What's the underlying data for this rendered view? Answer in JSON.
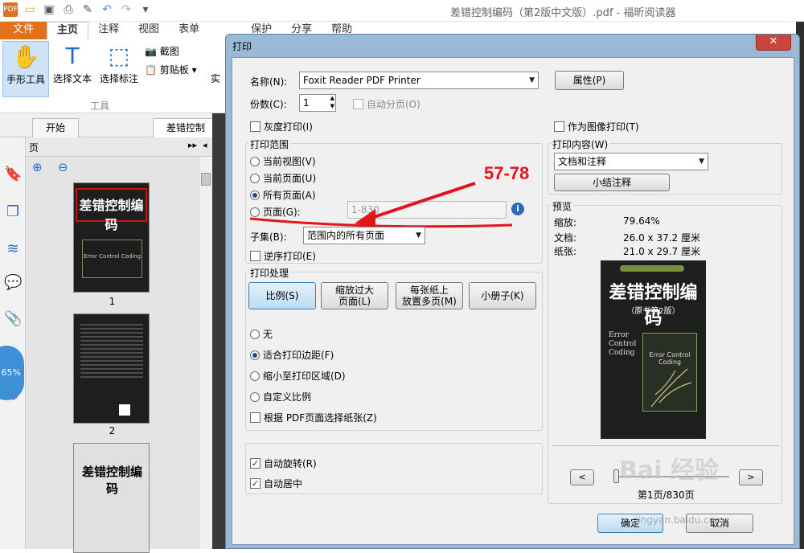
{
  "app": {
    "title": "差错控制编码（第2版中文版）.pdf - 福昕阅读器",
    "ribbon_tabs": [
      "文件",
      "主页",
      "注释",
      "视图",
      "表单",
      "保护",
      "分享",
      "帮助"
    ],
    "tools": {
      "hand": "手形工具",
      "select_text": "选择文本",
      "select_annot": "选择标注",
      "screenshot": "截图",
      "clipboard": "剪贴板",
      "partial": "实",
      "group_label": "工具"
    },
    "doc_tabs": [
      "开始",
      "差错控制编码"
    ],
    "panel_title": "页",
    "zoom": "65%",
    "thumbnails": [
      "1",
      "2"
    ],
    "thumb_text": {
      "cover_title": "差错控制编码",
      "cover_sub": "（原书第2版）",
      "cover_en": "Error Control Coding"
    }
  },
  "dialog": {
    "title": "打印",
    "close": "✕",
    "printer": {
      "name_label": "名称(N):",
      "name_value": "Foxit Reader PDF Printer",
      "properties": "属性(P)",
      "copies_label": "份数(C):",
      "copies_value": "1",
      "collate": "自动分页(O)",
      "grayscale": "灰度打印(I)",
      "as_image": "作为图像打印(T)"
    },
    "range": {
      "title": "打印范围",
      "current_view": "当前视图(V)",
      "current_page": "当前页面(U)",
      "all_pages": "所有页面(A)",
      "pages": "页面(G):",
      "pages_placeholder": "1-830",
      "subset_label": "子集(B):",
      "subset_value": "范围内的所有页面",
      "reverse": "逆序打印(E)",
      "annotation": "57-78"
    },
    "handling": {
      "title": "打印处理",
      "scale": "比例(S)",
      "fit_large_1": "缩放过大",
      "fit_large_2": "页面(L)",
      "multi_1": "每张纸上",
      "multi_2": "放置多页(M)",
      "booklet": "小册子(K)",
      "none": "无",
      "fit_margins": "适合打印边距(F)",
      "shrink": "缩小至打印区域(D)",
      "custom": "自定义比例",
      "choose_paper": "根据 PDF页面选择纸张(Z)"
    },
    "auto_rotate": "自动旋转(R)",
    "auto_center": "自动居中",
    "content": {
      "title": "打印内容(W)",
      "value": "文档和注释",
      "summarize": "小结注释"
    },
    "preview": {
      "title": "预览",
      "zoom_label": "缩放:",
      "zoom_value": "79.64%",
      "doc_label": "文档:",
      "doc_value": "26.0 x 37.2 厘米",
      "paper_label": "纸张:",
      "paper_value": "21.0 x 29.7 厘米",
      "cover_title": "差错控制编码",
      "cover_sub": "（原书第2版）",
      "cover_en1": "Error",
      "cover_en2": "Control",
      "cover_en3": "Coding",
      "cover_en4": "Error Control Coding",
      "prev": "<",
      "next": ">",
      "page_info": "第1页/830页"
    },
    "ok": "确定",
    "cancel": "取消"
  },
  "watermark": {
    "logo": "Bai 经验",
    "url": "jingyan.baidu.com"
  },
  "colors": {
    "file_tab": "#e2711d",
    "annotation_red": "#e0161b",
    "dialog_frame": "#9bb8d5",
    "accent_blue": "#1a70c8"
  }
}
